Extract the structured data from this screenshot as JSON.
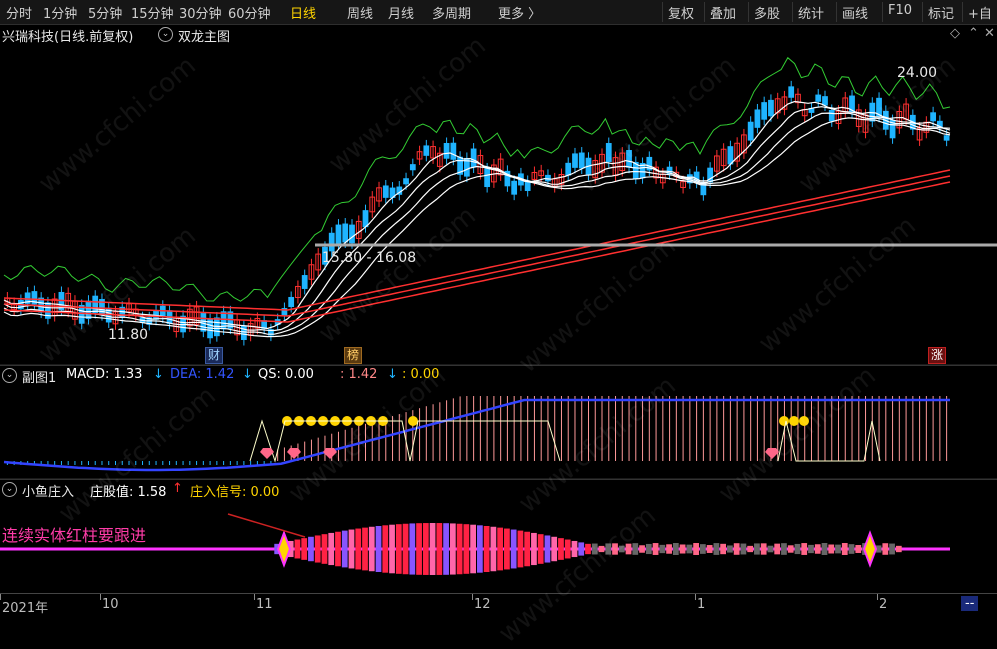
{
  "toolbar": {
    "periods": [
      "分时",
      "1分钟",
      "5分钟",
      "15分钟",
      "30分钟",
      "60分钟",
      "日线",
      "周线",
      "月线",
      "多周期",
      "更多 〉"
    ],
    "active_period": "日线",
    "right_buttons": [
      "复权",
      "叠加",
      "多股",
      "统计",
      "画线",
      "F10",
      "标记",
      "+自"
    ]
  },
  "main_panel": {
    "stock_name": "兴瑞科技(日线.前复权)",
    "indicator_name": "双龙主图",
    "high_label": "24.00",
    "low_label": "11.80",
    "gap_label": "15.80 - 16.08",
    "tags": {
      "cai": "财",
      "bang": "榜",
      "zhang": "涨"
    }
  },
  "macd_panel": {
    "name": "副图1",
    "macd_label": "MACD: 1.33",
    "dea_label": "DEA: 1.42",
    "qs_label": "QS: 0.00",
    "extra1": ": 1.42",
    "extra2": ": 0.00",
    "macd_arrow": "↓",
    "dea_arrow": "↓",
    "extra_arrow": "↓"
  },
  "fish_panel": {
    "name": "小鱼庄入",
    "value_label": "庄股值: 1.58",
    "value_arrow": "↑",
    "signal_label": "庄入信号: 0.00",
    "annotation": "连续实体红柱要跟进"
  },
  "date_axis": {
    "labels": [
      "2021年",
      "10",
      "11",
      "12",
      "1",
      "2"
    ],
    "corner": "--"
  },
  "watermark": "www.cfchi.com",
  "colors": {
    "up": "#ff3030",
    "down": "#1fb4ff",
    "ma": "#ffffff",
    "band": "#33cc33",
    "dea": "#3344ff",
    "macd_line": "#ff9999",
    "annotation": "#ff3ca8",
    "fish_center": "#ff33ff"
  }
}
